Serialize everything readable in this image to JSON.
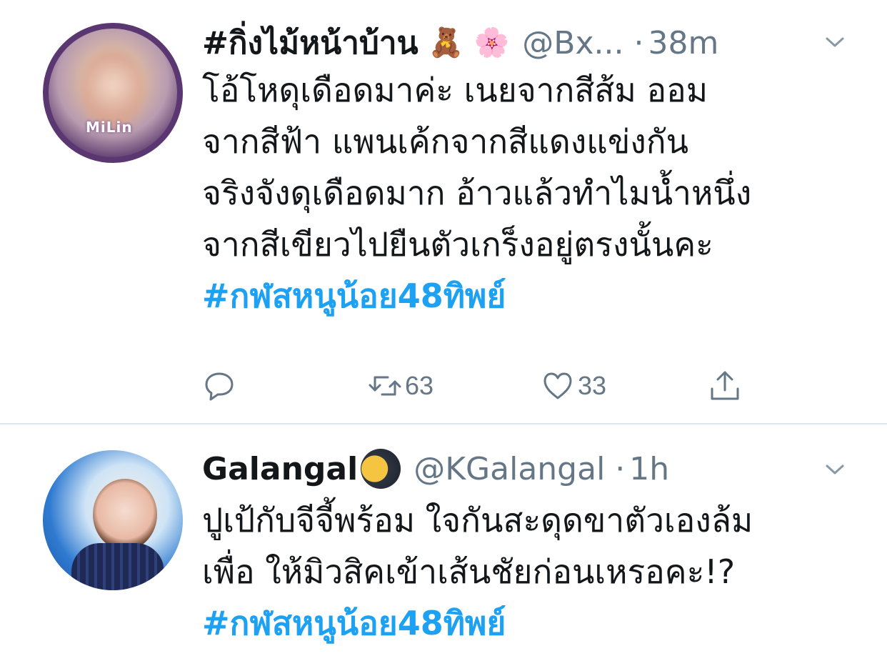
{
  "tweets": [
    {
      "display_name": "#กิ่งไม้หน้าบ้าน",
      "emojis": [
        "🧸",
        "🌸"
      ],
      "handle": "@Bx...",
      "dot": "·",
      "timestamp": "38m",
      "avatar_text": "MiLin",
      "body_lines": [
        "โอ้โหดุเดือดมาค่ะ เนยจากสีส้ม ออม",
        "จากสีฟ้า แพนเค้กจากสีแดงแข่งกัน",
        "จริงจังดุเดือดมาก อ้าวแล้วทำไมน้ำหนึ่ง",
        "จากสีเขียวไปยืนตัวเกร็งอยู่ตรงนั้นคะ"
      ],
      "hashtag": "#กฬสหนูน้อย48ทิพย์",
      "actions": {
        "reply_count": "",
        "retweet_count": "63",
        "like_count": "33"
      }
    },
    {
      "display_name": "Galangal",
      "handle": "@KGalangal",
      "dot": "·",
      "timestamp": "1h",
      "body_lines": [
        "ปูเป้กับจีจี้พร้อม ใจกันสะดุดขาตัวเองล้ม",
        "เพื่อ ให้มิวสิคเข้าเส้นชัยก่อนเหรอคะ!?"
      ],
      "hashtag": "#กฬสหนูน้อย48ทิพย์"
    }
  ],
  "colors": {
    "text": "#14171a",
    "secondary": "#657786",
    "link": "#1da1f2",
    "divider": "#e1e8ed"
  },
  "icons": {
    "reply": "reply-icon",
    "retweet": "retweet-icon",
    "like": "heart-icon",
    "share": "share-icon",
    "more": "chevron-down-icon"
  }
}
